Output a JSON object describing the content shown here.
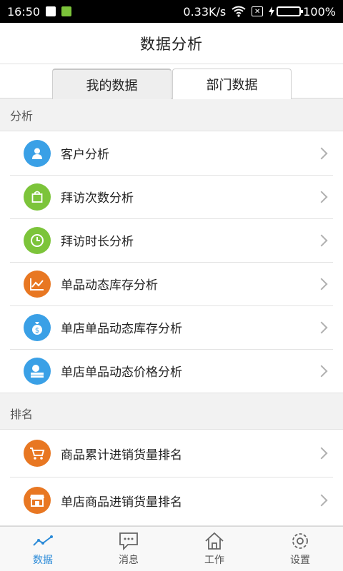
{
  "status_bar": {
    "time": "16:50",
    "network_speed": "0.33K/s",
    "battery": "100%",
    "battery_level": 1.0
  },
  "header": {
    "title": "数据分析"
  },
  "tabs": [
    {
      "label": "我的数据",
      "active": true
    },
    {
      "label": "部门数据",
      "active": false
    }
  ],
  "sections": {
    "analysis": {
      "label": "分析",
      "items": [
        {
          "label": "客户分析",
          "icon": "person-icon",
          "color": "#3aa0e6"
        },
        {
          "label": "拜访次数分析",
          "icon": "bag-icon",
          "color": "#7cc43a"
        },
        {
          "label": "拜访时长分析",
          "icon": "clock-icon",
          "color": "#7cc43a"
        },
        {
          "label": "单品动态库存分析",
          "icon": "line-chart-icon",
          "color": "#e87722"
        },
        {
          "label": "单店单品动态库存分析",
          "icon": "money-bag-icon",
          "color": "#3aa0e6"
        },
        {
          "label": "单店单品动态价格分析",
          "icon": "coins-icon",
          "color": "#3aa0e6"
        }
      ]
    },
    "ranking": {
      "label": "排名",
      "items": [
        {
          "label": "商品累计进销货量排名",
          "icon": "cart-icon",
          "color": "#e87722"
        },
        {
          "label": "单店商品进销货量排名",
          "icon": "store-icon",
          "color": "#e87722"
        }
      ]
    }
  },
  "bottom_nav": [
    {
      "label": "数据",
      "icon": "trend-icon",
      "active": true
    },
    {
      "label": "消息",
      "icon": "chat-icon",
      "active": false
    },
    {
      "label": "工作",
      "icon": "home-icon",
      "active": false
    },
    {
      "label": "设置",
      "icon": "gear-icon",
      "active": false
    }
  ],
  "colors": {
    "accent": "#2a8ad8",
    "blue": "#3aa0e6",
    "green": "#7cc43a",
    "orange": "#e87722"
  }
}
